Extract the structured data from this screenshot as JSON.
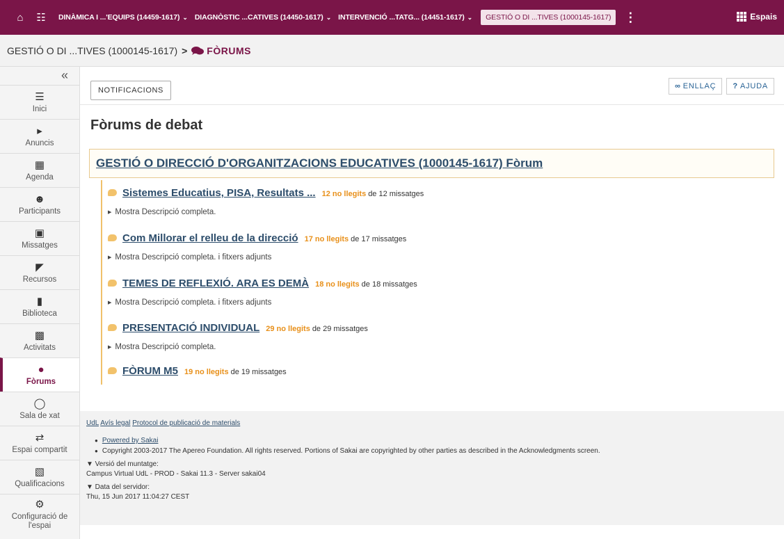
{
  "topbar": {
    "sites": [
      {
        "label": "DINÀMICA I ...'EQUIPS (14459-1617)"
      },
      {
        "label": "DIAGNÒSTIC ...CATIVES (14450-1617)"
      },
      {
        "label": "INTERVENCIÓ ...TATG... (14451-1617)"
      }
    ],
    "current_site": "GESTIÓ O DI ...TIVES (1000145-1617)",
    "more": "⋮",
    "espais": "Espais"
  },
  "breadcrumb": {
    "site": "GESTIÓ O DI ...TIVES (1000145-1617)",
    "separator": ">",
    "tool": "FÒRUMS"
  },
  "sidebar": {
    "collapse": "«",
    "items": [
      {
        "label": "Inici",
        "icon": "list-icon"
      },
      {
        "label": "Anuncis",
        "icon": "megaphone-icon"
      },
      {
        "label": "Agenda",
        "icon": "calendar-icon"
      },
      {
        "label": "Participants",
        "icon": "users-icon"
      },
      {
        "label": "Missatges",
        "icon": "inbox-icon"
      },
      {
        "label": "Recursos",
        "icon": "folder-icon"
      },
      {
        "label": "Biblioteca",
        "icon": "bookmark-icon"
      },
      {
        "label": "Activitats",
        "icon": "file-icon"
      },
      {
        "label": "Fòrums",
        "icon": "comments-icon"
      },
      {
        "label": "Sala de xat",
        "icon": "chat-icon"
      },
      {
        "label": "Espai compartit",
        "icon": "exchange-icon"
      },
      {
        "label": "Qualificacions",
        "icon": "book-icon"
      },
      {
        "label": "Configuració de l'espai",
        "icon": "gear-icon"
      }
    ]
  },
  "toolbar": {
    "notifications": "NOTIFICACIONS",
    "link": "ENLLAÇ",
    "help": "AJUDA"
  },
  "page": {
    "title": "Fòrums de debat",
    "forum_title": "GESTIÓ O DIRECCIÓ D'ORGANITZACIONS EDUCATIVES (1000145-1617) Fòrum"
  },
  "topics": [
    {
      "title": "Sistemes Educatius, PISA, Resultats ...",
      "unread": "12 no llegits",
      "total": "de 12 missatges",
      "desc": "Mostra Descripció completa."
    },
    {
      "title": "Com Millorar el relleu de la direcció",
      "unread": "17 no llegits",
      "total": "de 17 missatges",
      "desc": "Mostra Descripció completa. i fitxers adjunts"
    },
    {
      "title": "TEMES DE REFLEXIÓ. ARA ES DEMÀ",
      "unread": "18 no llegits",
      "total": "de 18 missatges",
      "desc": "Mostra Descripció completa. i fitxers adjunts"
    },
    {
      "title": "PRESENTACIÓ INDIVIDUAL",
      "unread": "29 no llegits",
      "total": "de 29 missatges",
      "desc": "Mostra Descripció completa."
    },
    {
      "title": "FÒRUM M5",
      "unread": "19 no llegits",
      "total": "de 19 missatges",
      "desc": ""
    }
  ],
  "footer": {
    "link_udl": "UdL",
    "link_legal": "Avís legal",
    "link_protocol": "Protocol de publicació de materials",
    "powered": "Powered by Sakai",
    "copyright": "Copyright 2003-2017 The Apereo Foundation. All rights reserved. Portions of Sakai are copyrighted by other parties as described in the Acknowledgments screen.",
    "version_label": "▼ Versió del muntatge:",
    "version_value": "Campus Virtual UdL - PROD - Sakai 11.3 - Server sakai04",
    "date_label": "▼ Data del servidor:",
    "date_value": "Thu, 15 Jun 2017 11:04:27 CEST"
  },
  "colors": {
    "brand": "#7a1548",
    "accent_unread": "#e8901a",
    "link": "#2d4d6b"
  }
}
